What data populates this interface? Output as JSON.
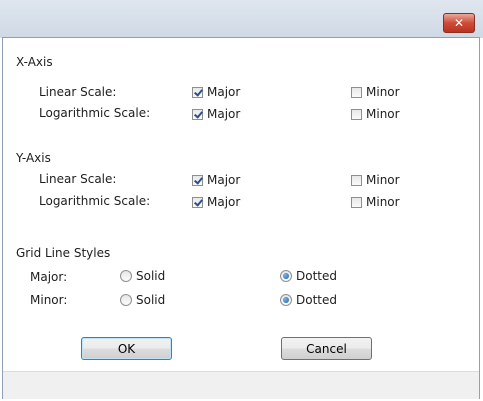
{
  "window": {
    "close_glyph": "✕"
  },
  "x_axis": {
    "heading": "X-Axis",
    "rows": [
      {
        "label": "Linear Scale:",
        "major": {
          "label": "Major",
          "checked": true
        },
        "minor": {
          "label": "Minor",
          "checked": false
        }
      },
      {
        "label": "Logarithmic Scale:",
        "major": {
          "label": "Major",
          "checked": true
        },
        "minor": {
          "label": "Minor",
          "checked": false
        }
      }
    ]
  },
  "y_axis": {
    "heading": "Y-Axis",
    "rows": [
      {
        "label": "Linear Scale:",
        "major": {
          "label": "Major",
          "checked": true
        },
        "minor": {
          "label": "Minor",
          "checked": false
        }
      },
      {
        "label": "Logarithmic Scale:",
        "major": {
          "label": "Major",
          "checked": true
        },
        "minor": {
          "label": "Minor",
          "checked": false
        }
      }
    ]
  },
  "grid_styles": {
    "heading": "Grid Line Styles",
    "rows": [
      {
        "label": "Major:",
        "solid_label": "Solid",
        "dotted_label": "Dotted",
        "selected": "Dotted"
      },
      {
        "label": "Minor:",
        "solid_label": "Solid",
        "dotted_label": "Dotted",
        "selected": "Dotted"
      }
    ]
  },
  "buttons": {
    "ok": "OK",
    "cancel": "Cancel"
  },
  "colors": {
    "close_button": "#cf4b37",
    "default_button_border": "#3c7fb1",
    "radio_selected": "#1c5ea8"
  }
}
